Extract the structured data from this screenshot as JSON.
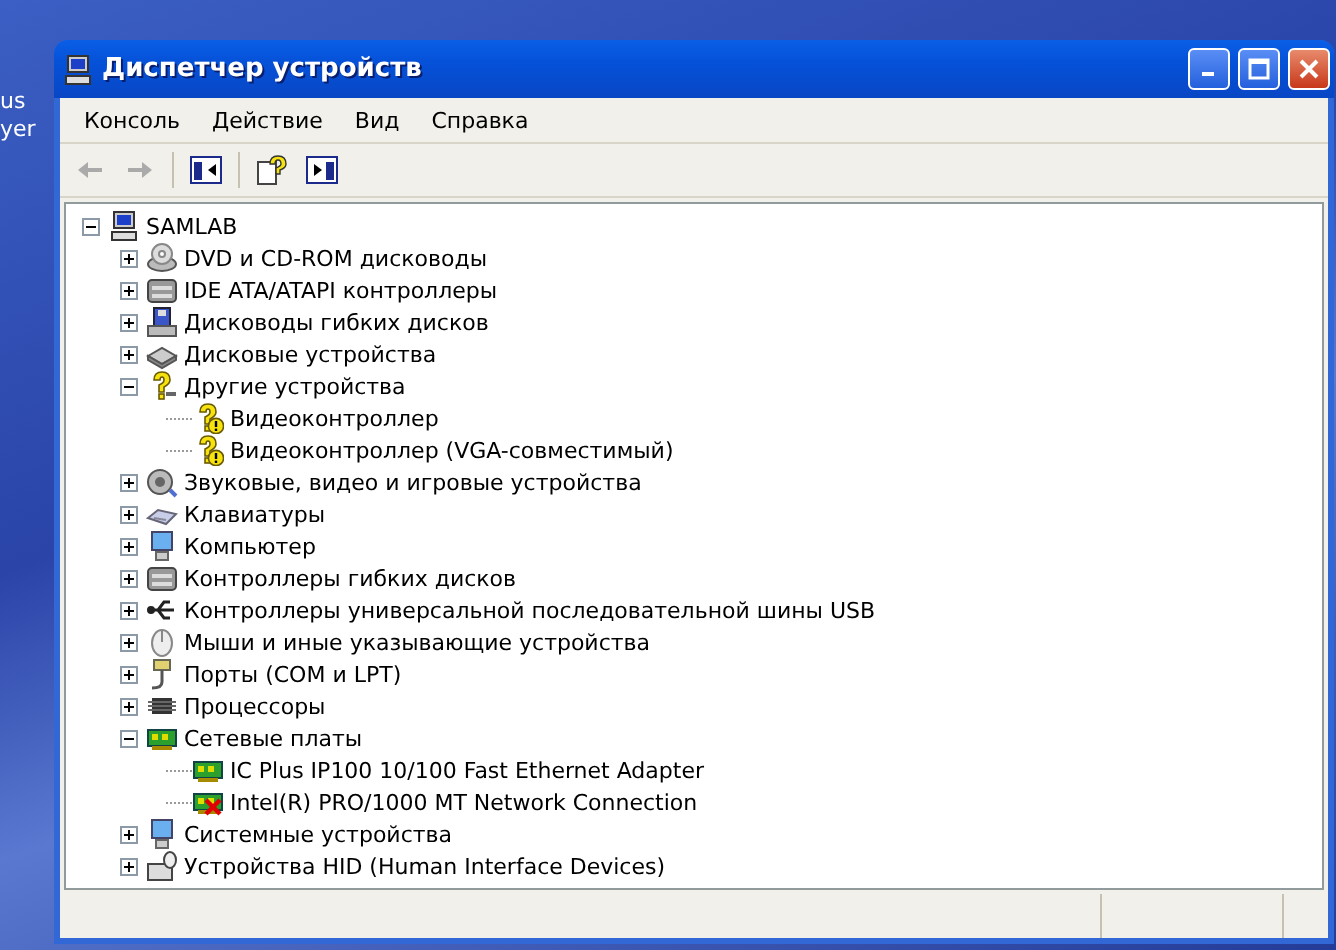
{
  "desktop": {
    "labels": [
      "us",
      "yer"
    ]
  },
  "window": {
    "title": "Диспетчер устройств"
  },
  "menu": [
    "Консоль",
    "Действие",
    "Вид",
    "Справка"
  ],
  "toolbar": [
    {
      "kind": "back",
      "disabled": true
    },
    {
      "kind": "forward",
      "disabled": true
    },
    {
      "kind": "separator"
    },
    {
      "kind": "tree"
    },
    {
      "kind": "separator"
    },
    {
      "kind": "help"
    },
    {
      "kind": "pane"
    }
  ],
  "tree": {
    "label": "SAMLAB",
    "kind": "computer",
    "expanded": true,
    "children": [
      {
        "label": "DVD и CD-ROM дисководы",
        "kind": "disc",
        "expanded": false
      },
      {
        "label": "IDE ATA/ATAPI контроллеры",
        "kind": "controller",
        "expanded": false
      },
      {
        "label": "Дисководы гибких дисков",
        "kind": "floppy",
        "expanded": false
      },
      {
        "label": "Дисковые устройства",
        "kind": "disk",
        "expanded": false
      },
      {
        "label": "Другие устройства",
        "kind": "unknown",
        "expanded": true,
        "children": [
          {
            "label": "Видеоконтроллер",
            "kind": "unknown",
            "warning": true
          },
          {
            "label": "Видеоконтроллер (VGA-совместимый)",
            "kind": "unknown",
            "warning": true
          }
        ]
      },
      {
        "label": "Звуковые, видео и игровые устройства",
        "kind": "sound",
        "expanded": false
      },
      {
        "label": "Клавиатуры",
        "kind": "keyboard",
        "expanded": false
      },
      {
        "label": "Компьютер",
        "kind": "monitor",
        "expanded": false
      },
      {
        "label": "Контроллеры гибких дисков",
        "kind": "controller",
        "expanded": false
      },
      {
        "label": "Контроллеры универсальной последовательной шины USB",
        "kind": "usb",
        "expanded": false
      },
      {
        "label": "Мыши и иные указывающие устройства",
        "kind": "mouse",
        "expanded": false
      },
      {
        "label": "Порты (COM и LPT)",
        "kind": "port",
        "expanded": false
      },
      {
        "label": "Процессоры",
        "kind": "cpu",
        "expanded": false
      },
      {
        "label": "Сетевые платы",
        "kind": "netcard",
        "expanded": true,
        "children": [
          {
            "label": "IC Plus IP100 10/100 Fast Ethernet Adapter",
            "kind": "netcard",
            "disabled": false
          },
          {
            "label": "Intel(R) PRO/1000 MT Network Connection",
            "kind": "netcard",
            "disabled": true
          }
        ]
      },
      {
        "label": "Системные устройства",
        "kind": "monitor",
        "expanded": false
      },
      {
        "label": "Устройства HID (Human Interface Devices)",
        "kind": "hid",
        "expanded": false
      }
    ]
  }
}
